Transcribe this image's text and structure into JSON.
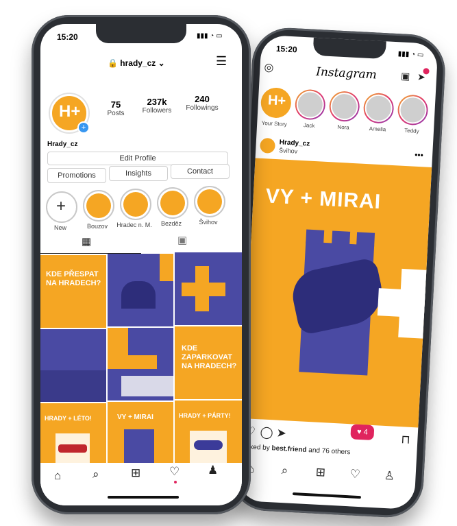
{
  "left_phone": {
    "status_time": "15:20",
    "username": "hrady_cz",
    "stats": [
      {
        "value": "75",
        "label": "Posts"
      },
      {
        "value": "237k",
        "label": "Followers"
      },
      {
        "value": "240",
        "label": "Followings"
      }
    ],
    "display_name": "Hrady_cz",
    "edit_profile": "Edit Profile",
    "actions": [
      "Promotions",
      "Insights",
      "Contact"
    ],
    "highlights": [
      "New",
      "Bouzov",
      "Hradec n. M.",
      "Bezděz",
      "Švihov"
    ],
    "posts": [
      {
        "text": "KDE PŘESPAT NA HRADECH?"
      },
      {
        "text": ""
      },
      {
        "text": ""
      },
      {
        "text": ""
      },
      {
        "text": ""
      },
      {
        "text": "KDE ZAPARKOVAT NA HRADECH?"
      },
      {
        "text": "HRADY + LÉTO!"
      },
      {
        "text": "VY + MIRAI"
      },
      {
        "text": "HRADY + PÁRTY!"
      }
    ]
  },
  "right_phone": {
    "status_time": "15:20",
    "app_title": "Instagram",
    "stories": [
      "Your Story",
      "Jack",
      "Nora",
      "Amelia",
      "Teddy"
    ],
    "post_user": "Hrady_cz",
    "post_location": "Švihov",
    "post_headline": "VY + MIRAI",
    "likes_text_prefix": "Liked by",
    "likes_user": "best.friend",
    "likes_text_suffix": "and 76 others",
    "notification_count": "4"
  },
  "colors": {
    "brand_orange": "#f5a623",
    "brand_purple": "#4a4aa3"
  }
}
